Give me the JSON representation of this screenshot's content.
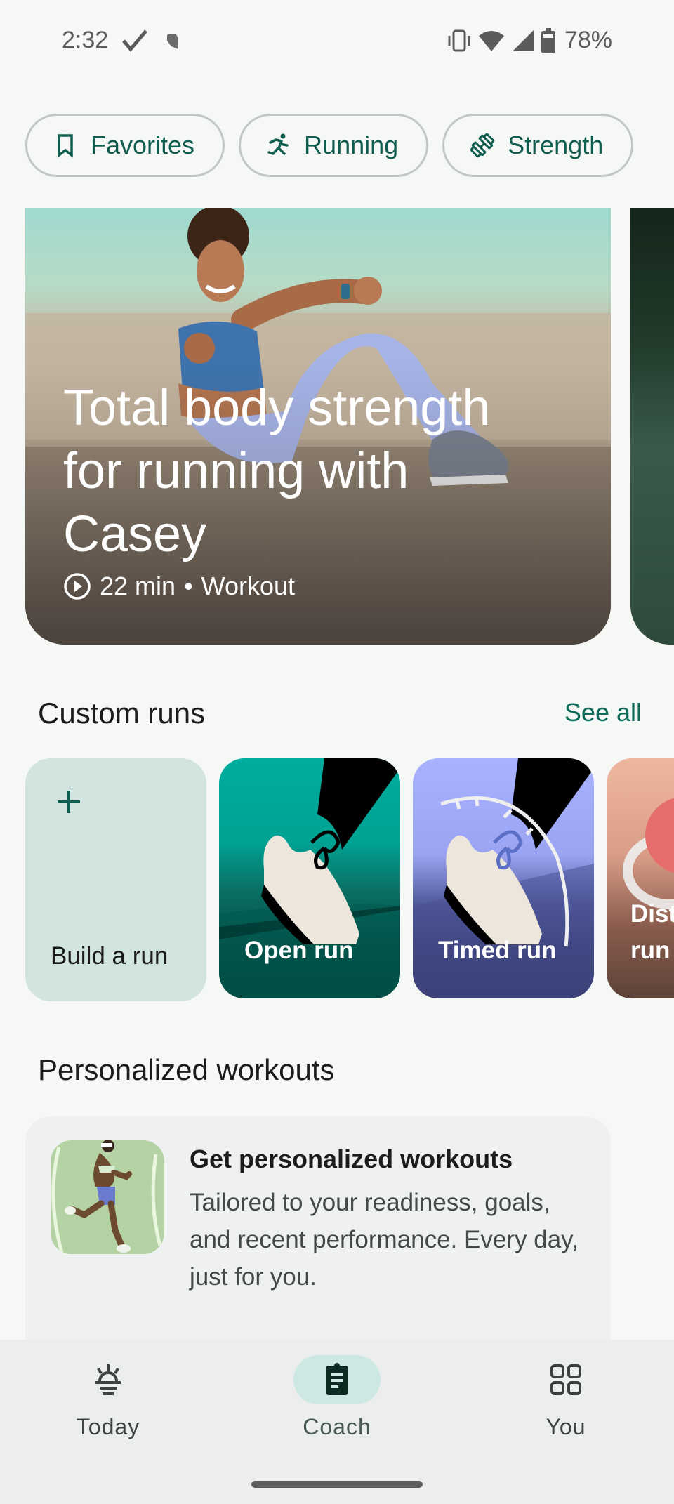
{
  "status_bar": {
    "time": "2:32",
    "left_icons": [
      "check-icon",
      "notification-icon"
    ],
    "right_icons": [
      "vibrate-icon",
      "wifi-icon",
      "signal-icon",
      "battery-icon"
    ],
    "battery": "78%"
  },
  "filter_chips": [
    {
      "label": "Favorites",
      "icon": "bookmark-icon"
    },
    {
      "label": "Running",
      "icon": "running-icon"
    },
    {
      "label": "Strength",
      "icon": "dumbbell-icon"
    }
  ],
  "featured": {
    "title": "Total body strength for running with Casey",
    "duration": "22 min",
    "separator": "•",
    "type": "Workout",
    "meta_icon": "play-circle-icon"
  },
  "custom_runs": {
    "title": "Custom runs",
    "see_all": "See all",
    "cards": [
      {
        "label": "Build a run",
        "icon": "plus-icon"
      },
      {
        "label": "Open run"
      },
      {
        "label": "Timed run"
      },
      {
        "label": "Distance run"
      }
    ]
  },
  "personalized": {
    "section_title": "Personalized workouts",
    "card_title": "Get personalized workouts",
    "card_description": "Tailored to your readiness, goals, and recent performance. Every day, just for you."
  },
  "bottom_nav": {
    "items": [
      {
        "label": "Today",
        "icon": "sunrise-icon",
        "active": false
      },
      {
        "label": "Coach",
        "icon": "clipboard-icon",
        "active": true
      },
      {
        "label": "You",
        "icon": "grid-icon",
        "active": false
      }
    ]
  },
  "colors": {
    "accent": "#0f6b5a",
    "background": "#f6f8f6",
    "nav_active_pill": "#cde8e2"
  }
}
